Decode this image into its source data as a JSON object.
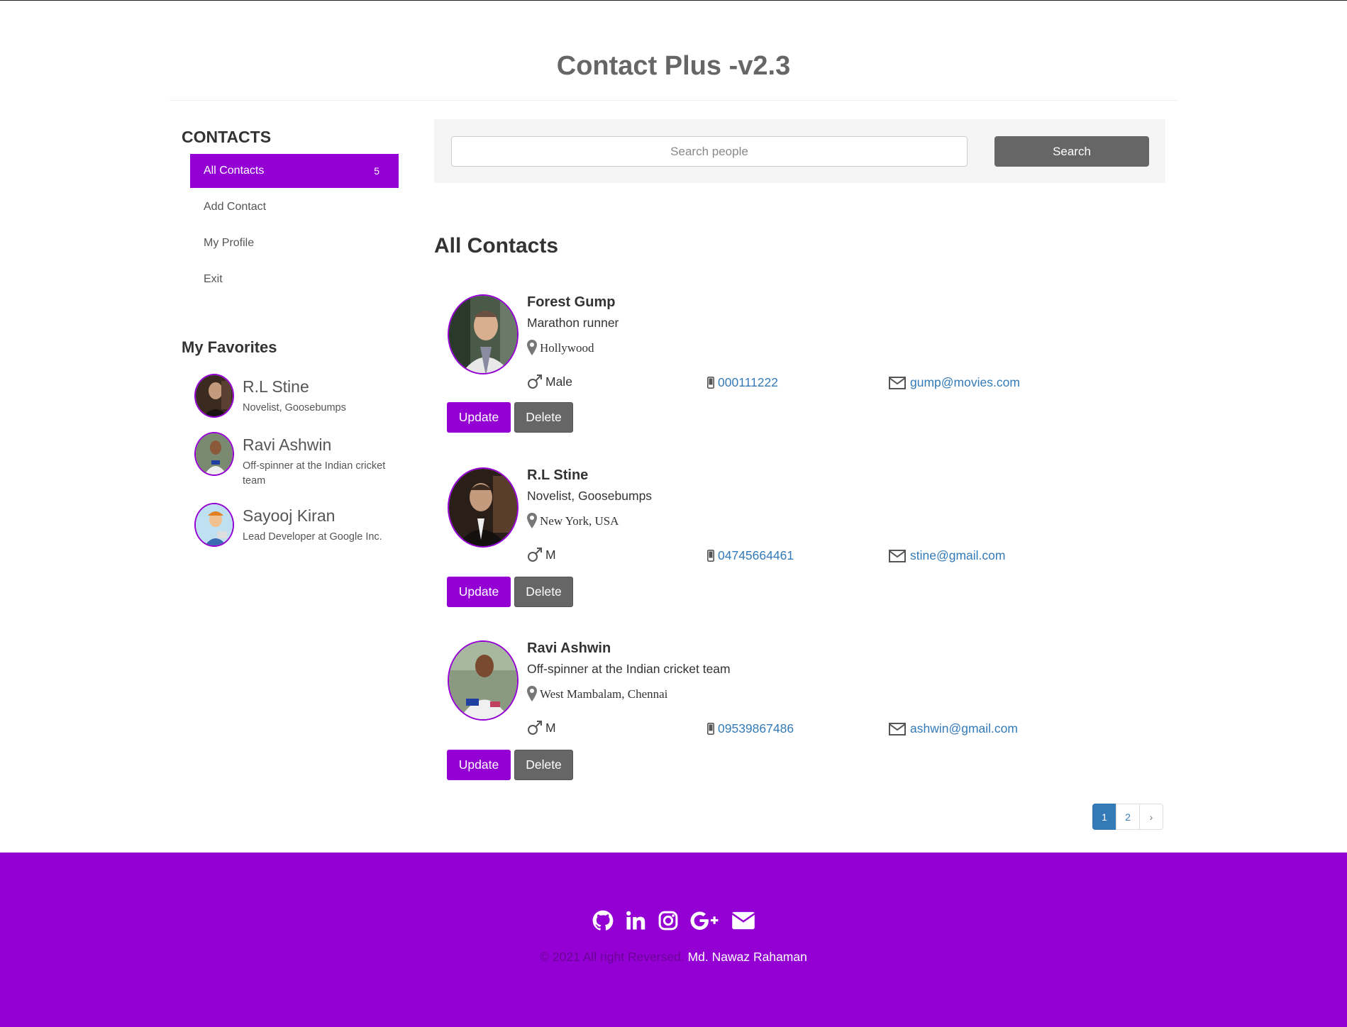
{
  "app": {
    "title": "Contact Plus -v2.3"
  },
  "colors": {
    "accent": "#9400d3",
    "dark_button": "#666666",
    "link": "#337ab7"
  },
  "sidebar": {
    "heading": "CONTACTS",
    "items": [
      {
        "label": "All Contacts",
        "badge": "5",
        "active": true
      },
      {
        "label": "Add Contact"
      },
      {
        "label": "My Profile"
      },
      {
        "label": "Exit"
      }
    ],
    "favorites_heading": "My Favorites",
    "favorites": [
      {
        "name": "R.L Stine",
        "desc": "Novelist, Goosebumps"
      },
      {
        "name": "Ravi Ashwin",
        "desc": "Off-spinner at the Indian cricket team"
      },
      {
        "name": "Sayooj Kiran",
        "desc": "Lead Developer at Google Inc."
      }
    ]
  },
  "search": {
    "placeholder": "Search people",
    "button_label": "Search"
  },
  "main": {
    "title": "All Contacts",
    "contacts": [
      {
        "name": "Forest Gump",
        "desc": "Marathon runner",
        "location": "Hollywood",
        "gender": "Male",
        "phone": "000111222",
        "email": "gump@movies.com",
        "update_label": "Update",
        "delete_label": "Delete"
      },
      {
        "name": "R.L Stine",
        "desc": "Novelist, Goosebumps",
        "location": "New York, USA",
        "gender": "M",
        "phone": "04745664461",
        "email": "stine@gmail.com",
        "update_label": "Update",
        "delete_label": "Delete"
      },
      {
        "name": "Ravi Ashwin",
        "desc": "Off-spinner at the Indian cricket team",
        "location": "West Mambalam, Chennai",
        "gender": "M",
        "phone": "09539867486",
        "email": "ashwin@gmail.com",
        "update_label": "Update",
        "delete_label": "Delete"
      }
    ]
  },
  "pagination": {
    "pages": [
      "1",
      "2"
    ],
    "current": "1",
    "next": "›"
  },
  "footer": {
    "icons": [
      "github-icon",
      "linkedin-icon",
      "instagram-icon",
      "google-plus-icon",
      "envelope-icon"
    ],
    "copyright": "© 2021 All right Reversed.",
    "author": "Md. Nawaz Rahaman"
  }
}
